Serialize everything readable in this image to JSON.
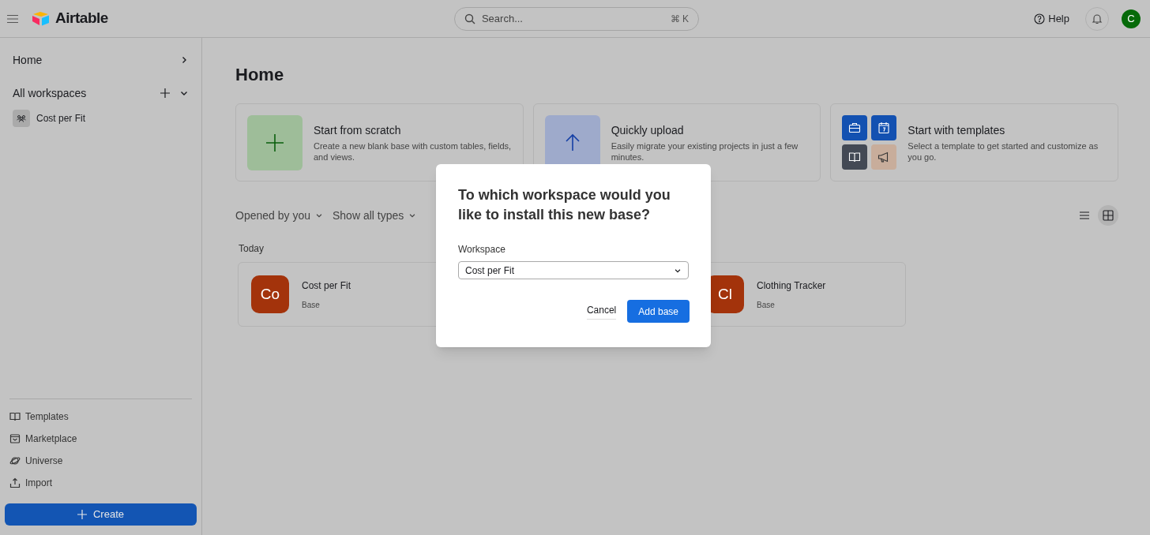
{
  "header": {
    "brand": "Airtable",
    "search": {
      "placeholder": "Search...",
      "shortcut": "⌘ K"
    },
    "help": "Help",
    "avatar": "C"
  },
  "sidebar": {
    "home": "Home",
    "workspaces_label": "All workspaces",
    "workspaces": [
      {
        "name": "Cost per Fit"
      }
    ],
    "links": [
      {
        "label": "Templates",
        "kind": "book"
      },
      {
        "label": "Marketplace",
        "kind": "store"
      },
      {
        "label": "Universe",
        "kind": "planet"
      },
      {
        "label": "Import",
        "kind": "upload"
      }
    ],
    "create": "Create"
  },
  "main": {
    "title": "Home",
    "start_cards": [
      {
        "kind": "scratch",
        "title": "Start from scratch",
        "description": "Create a new blank base with custom tables, fields, and views."
      },
      {
        "kind": "upload",
        "title": "Quickly upload",
        "description": "Easily migrate your existing projects in just a few minutes."
      },
      {
        "kind": "templates",
        "title": "Start with templates",
        "description": "Select a template to get started and customize as you go."
      }
    ],
    "filters": [
      "Opened by you",
      "Show all types"
    ],
    "view_toggle": [
      {
        "kind": "list",
        "selected": false
      },
      {
        "kind": "grid",
        "selected": true
      }
    ],
    "section": "Today",
    "bases": [
      {
        "initials": "Co",
        "name": "Cost per Fit",
        "type": "Base",
        "color": "#a3330b"
      },
      {
        "initials": "Cl",
        "name": "Clothing Tracker",
        "type": "Base",
        "color": "#a3330b"
      }
    ]
  },
  "dialog": {
    "title": "To which workspace would you like to install this new base?",
    "field_label": "Workspace",
    "value": "Cost per Fit",
    "cancel": "Cancel",
    "confirm": "Add base"
  }
}
